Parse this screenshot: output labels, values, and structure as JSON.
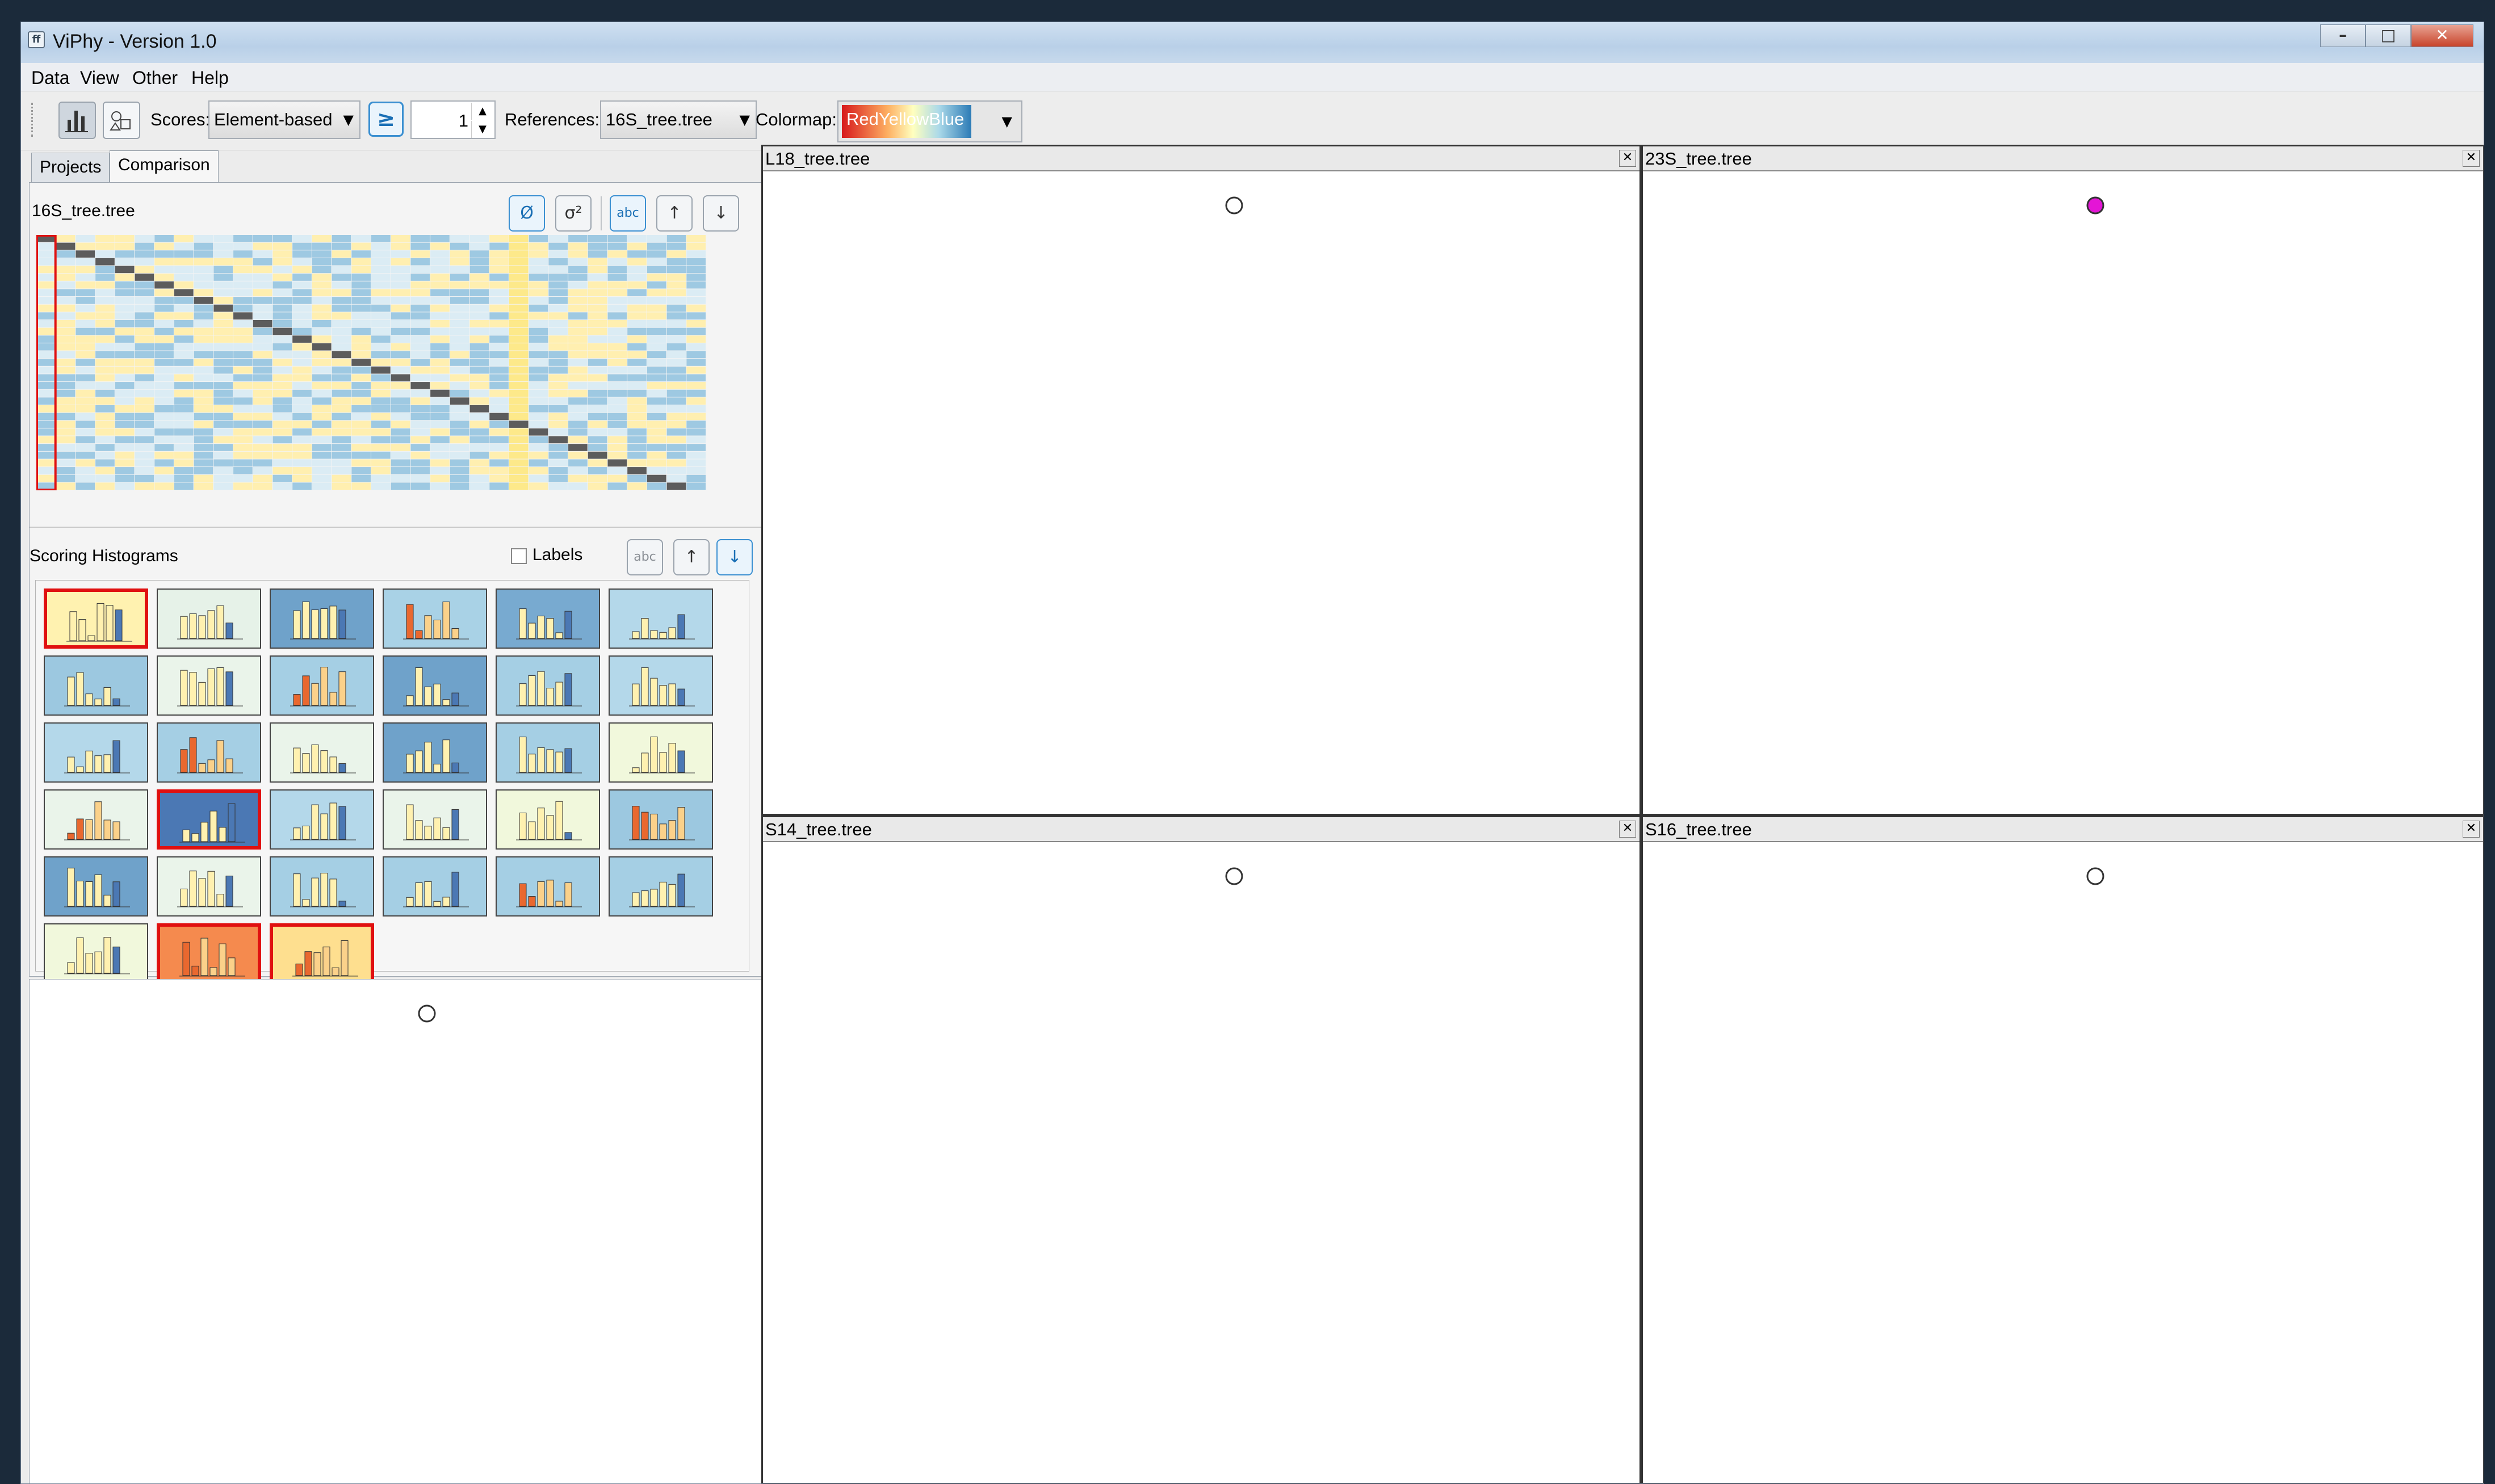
{
  "window": {
    "title": "ViPhy - Version 1.0",
    "controls": {
      "minimize": "–",
      "maximize": "□",
      "close": "✕"
    }
  },
  "menu": [
    "Data",
    "View",
    "Other",
    "Help"
  ],
  "toolbar": {
    "scores_label": "Scores:",
    "scores_value": "Element-based",
    "compare_symbol": "≥",
    "threshold_value": "1",
    "references_label": "References:",
    "references_value": "16S_tree.tree",
    "colormap_label": "Colormap:",
    "colormap_value": "RedYellowBlue",
    "icons": [
      "bar-chart-icon",
      "shapes-icon"
    ]
  },
  "tabs": [
    {
      "label": "Projects",
      "active": false
    },
    {
      "label": "Comparison",
      "active": true
    }
  ],
  "comparison": {
    "reference_label": "16S_tree.tree",
    "buttons": [
      {
        "glyph": "Ø",
        "name": "empty-set-button"
      },
      {
        "glyph": "σ²",
        "name": "variance-button"
      },
      {
        "glyph": "abc",
        "name": "labels-button"
      },
      {
        "glyph": "↑",
        "name": "sort-up-button"
      },
      {
        "glyph": "↓",
        "name": "sort-down-button"
      }
    ]
  },
  "histograms": {
    "title": "Scoring Histograms",
    "labels_checkbox": "Labels",
    "labels_checked": false,
    "button_abc": "abc",
    "button_up": "↑",
    "button_down": "↓",
    "tiles": [
      {
        "bg": "#fff2b0",
        "sel": true
      },
      {
        "bg": "#e6f2e8",
        "sel": false
      },
      {
        "bg": "#6fa2ca",
        "sel": false
      },
      {
        "bg": "#a9d2e6",
        "sel": false
      },
      {
        "bg": "#78aad0",
        "sel": false
      },
      {
        "bg": "#b4d8ea",
        "sel": false
      },
      {
        "bg": "#9cc8e0",
        "sel": false
      },
      {
        "bg": "#eaf4ea",
        "sel": false
      },
      {
        "bg": "#a5cfe4",
        "sel": false
      },
      {
        "bg": "#6fa2ca",
        "sel": false
      },
      {
        "bg": "#a5cfe4",
        "sel": false
      },
      {
        "bg": "#b4d8ea",
        "sel": false
      },
      {
        "bg": "#b4d8ea",
        "sel": false
      },
      {
        "bg": "#a5cfe4",
        "sel": false
      },
      {
        "bg": "#eaf4ea",
        "sel": false
      },
      {
        "bg": "#6fa2ca",
        "sel": false
      },
      {
        "bg": "#a5cfe4",
        "sel": false
      },
      {
        "bg": "#f1f8dc",
        "sel": false
      },
      {
        "bg": "#eaf4ea",
        "sel": false
      },
      {
        "bg": "#4b78b4",
        "sel": true
      },
      {
        "bg": "#b4d8ea",
        "sel": false
      },
      {
        "bg": "#eaf4ea",
        "sel": false
      },
      {
        "bg": "#f1f8dc",
        "sel": false
      },
      {
        "bg": "#9cc8e0",
        "sel": false
      },
      {
        "bg": "#6fa2ca",
        "sel": false
      },
      {
        "bg": "#eaf4ea",
        "sel": false
      },
      {
        "bg": "#a5cfe4",
        "sel": false
      },
      {
        "bg": "#a5cfe4",
        "sel": false
      },
      {
        "bg": "#a5cfe4",
        "sel": false
      },
      {
        "bg": "#a5cfe4",
        "sel": false
      },
      {
        "bg": "#f1f8dc",
        "sel": false
      },
      {
        "bg": "#f58a4e",
        "sel": true
      },
      {
        "bg": "#fedf8f",
        "sel": true
      }
    ]
  },
  "panels": [
    {
      "title": "L18_tree.tree",
      "close": "✕"
    },
    {
      "title": "23S_tree.tree",
      "close": "✕"
    },
    {
      "title": "S14_tree.tree",
      "close": "✕"
    },
    {
      "title": "S16_tree.tree",
      "close": "✕"
    }
  ],
  "colors": {
    "tan": "#fff1b0",
    "orange": "#f9c37c",
    "blue": "#5f8fc0",
    "lightblue": "#c6e0ee",
    "magenta": "#e415d6",
    "highlight": "#e01010",
    "matrix_pale": "#ffefb0",
    "matrix_blue": "#9ec9e2",
    "matrix_light": "#dbecf4"
  }
}
